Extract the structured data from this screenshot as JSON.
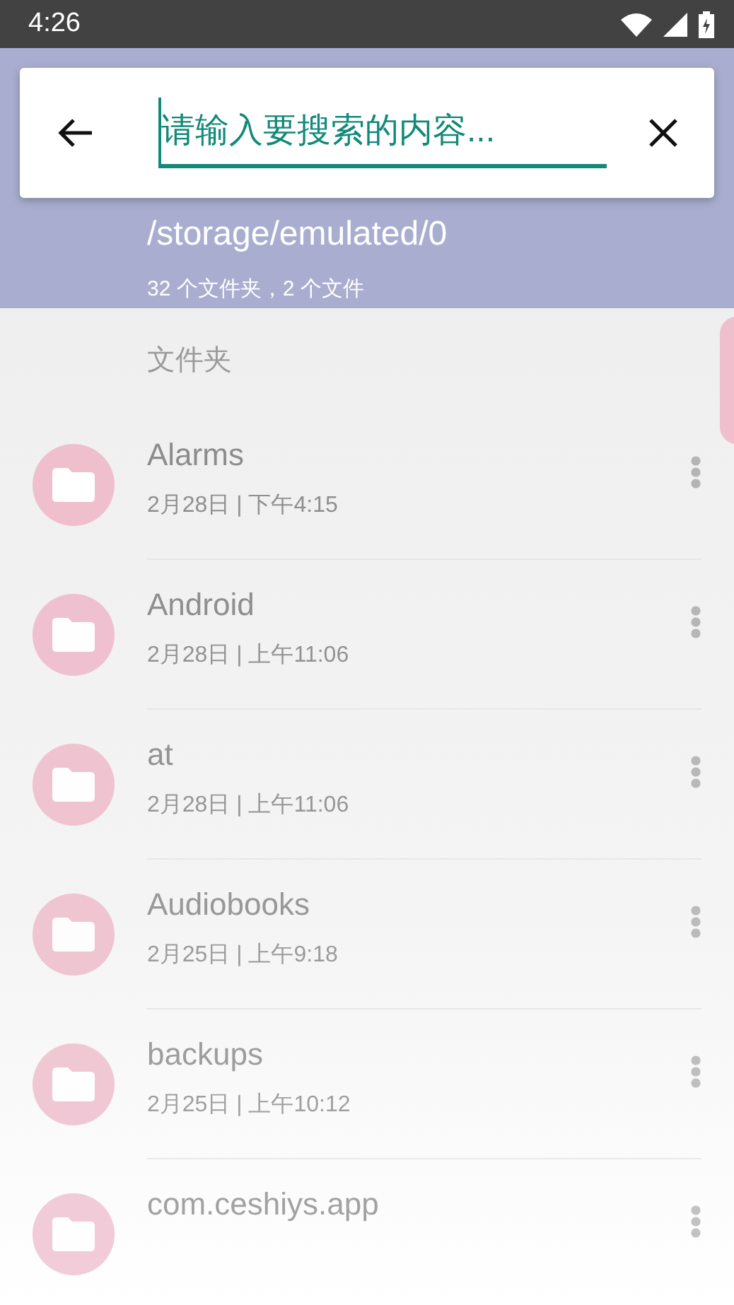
{
  "status_bar": {
    "time": "4:26"
  },
  "search": {
    "placeholder": "请输入要搜索的内容..."
  },
  "header": {
    "path": "/storage/emulated/0",
    "summary": "32 个文件夹，2 个文件"
  },
  "section": "文件夹",
  "folders": [
    {
      "name": "Alarms",
      "date": "2月28日 | 下午4:15"
    },
    {
      "name": "Android",
      "date": "2月28日 | 上午11:06"
    },
    {
      "name": "at",
      "date": "2月28日 | 上午11:06"
    },
    {
      "name": "Audiobooks",
      "date": "2月25日 | 上午9:18"
    },
    {
      "name": "backups",
      "date": "2月25日 | 上午10:12"
    },
    {
      "name": "com.ceshiys.app"
    }
  ]
}
